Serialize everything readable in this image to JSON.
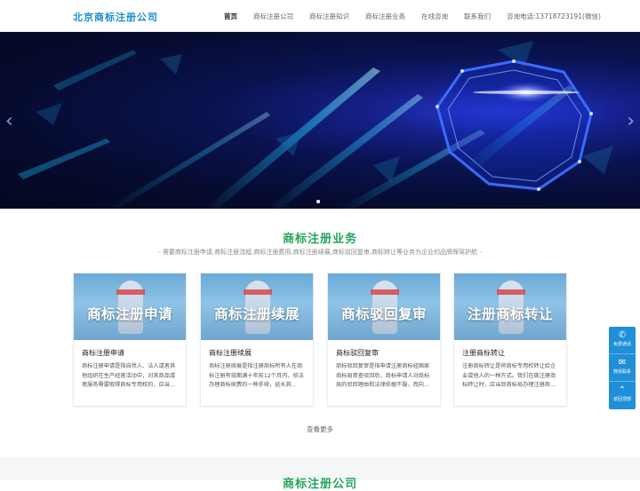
{
  "header": {
    "logo": "北京商标注册公司",
    "nav": [
      "首页",
      "商标注册公司",
      "商标注册知识",
      "商标注册业务",
      "在线咨询",
      "联系我们"
    ],
    "phone": "咨询电话:13718723191(微信)"
  },
  "banner": {
    "prev_icon": "chevron-left-icon",
    "next_icon": "chevron-right-icon"
  },
  "services": {
    "title": "商标注册业务",
    "subtitle": "- 需要商标注册申请,商标注册流程,商标注册费用,商标注册续展,商标驳回复审,商标转让等业务为企业的品牌保驾护航 -",
    "cards": [
      {
        "image_caption": "商标注册申请",
        "title": "商标注册申请",
        "text": "商标注册申请是指自然人、法人或者其他组织在生产经营活动中，对其商品或者服务需要取得商标专用权的，应当..."
      },
      {
        "image_caption": "商标注册续展",
        "title": "商标注册续展",
        "text": "商标注册续展是指注册商标所有人在商标注册有效期满十年前12个月内，依法办理商标续费的一种手续，延长其..."
      },
      {
        "image_caption": "商标驳回复审",
        "title": "商标驳回复审",
        "text": "商标驳回复审是指申请注册商标经国家商标局审查驳回后，商标申请人对商标局的驳回理由和法律依据不服，而向..."
      },
      {
        "image_caption": "注册商标转让",
        "title": "注册商标转让",
        "text": "注册商标转让是将商标专用权转让给企业或他人的一种方式。我们在做注册商标转让时，应当到商标局办理注册商..."
      }
    ],
    "more": "查看更多"
  },
  "next_section": {
    "title": "商标注册公司"
  },
  "sidebar": {
    "items": [
      {
        "icon": "phone-icon",
        "glyph": "✆",
        "label": "免费通话"
      },
      {
        "icon": "wechat-icon",
        "glyph": "✉",
        "label": "微信联系"
      },
      {
        "icon": "chevron-up-icon",
        "glyph": "⌃",
        "label": "返回顶部"
      }
    ]
  },
  "colors": {
    "accent_green": "#23a55a",
    "link_blue": "#1b8fd0",
    "sidebar_blue": "#1f8fd8"
  }
}
